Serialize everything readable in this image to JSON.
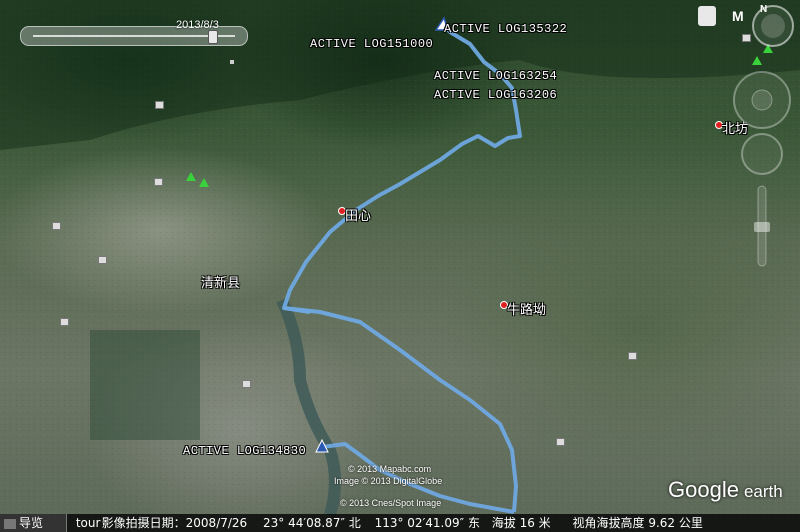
{
  "timeline": {
    "date": "2013/8/3"
  },
  "track_labels": [
    "ACTIVE LOG135322",
    "ACTIVE LOG151000",
    "ACTIVE LOG163254",
    "ACTIVE LOG163206",
    "ACTIVE LOG134830"
  ],
  "places": {
    "beifang": "北坊",
    "tianxin": "田心",
    "qingxin": "清新县",
    "niulu": "牛路坳"
  },
  "copyright": [
    "© 2013 Mapabc.com",
    "Image © 2013 DigitalGlobe",
    "© 2013 Cnes/Spot Image"
  ],
  "nav_controls": {
    "north_label": "N",
    "mode_label": "M"
  },
  "brand": {
    "google": "Google",
    "earth": "earth"
  },
  "status": {
    "nav_tab": "导览",
    "tour_label": "tour",
    "imagery_date": "影像拍摄日期：2008/7/26",
    "lat": "23° 44′08.87″ 北",
    "lon": "113° 02′41.09″ 东",
    "elev": "海拔     16 米",
    "eye_alt": "视角海拔高度   9.62 公里"
  },
  "colors": {
    "track": "#6fa8e0",
    "place_dot": "#e02020",
    "text": "#ffffff"
  }
}
